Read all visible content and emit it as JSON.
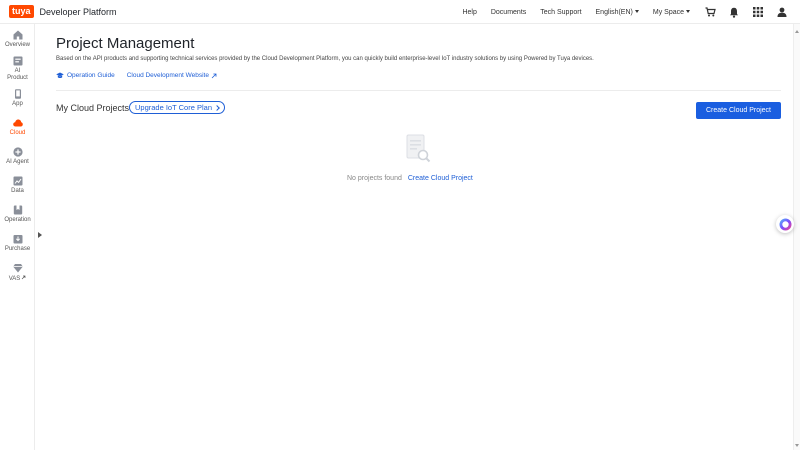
{
  "header": {
    "logo_text": "tuya",
    "brand": "Developer Platform",
    "nav": {
      "help": "Help",
      "documents": "Documents",
      "tech_support": "Tech Support",
      "language": "English(EN)",
      "space": "My Space"
    },
    "icons": [
      "cart-icon",
      "bell-icon",
      "apps-grid-icon",
      "user-icon"
    ]
  },
  "sidebar": {
    "items": [
      {
        "label": "Overview",
        "icon": "home-icon"
      },
      {
        "label": "AI Product",
        "icon": "ai-product-icon"
      },
      {
        "label": "App",
        "icon": "phone-icon"
      },
      {
        "label": "Cloud",
        "icon": "cloud-icon",
        "active": true
      },
      {
        "label": "AI Agent",
        "icon": "plus-circle-icon"
      },
      {
        "label": "Data",
        "icon": "chart-icon"
      },
      {
        "label": "Operation",
        "icon": "bookmark-icon"
      },
      {
        "label": "Purchase",
        "icon": "download-box-icon"
      },
      {
        "label": "VAS",
        "icon": "diamond-icon"
      }
    ]
  },
  "main": {
    "title": "Project Management",
    "description": "Based on the API products and supporting technical services provided by the Cloud Development Platform, you can quickly build enterprise-level IoT industry solutions by using Powered by Tuya devices.",
    "links": {
      "operation_guide": "Operation Guide",
      "cloud_dev_website": "Cloud Development Website"
    },
    "section_title": "My Cloud Projects",
    "upgrade_pill": "Upgrade IoT Core Plan",
    "create_button": "Create Cloud Project",
    "empty": {
      "text": "No projects found",
      "link": "Create Cloud Project"
    }
  },
  "colors": {
    "brand_orange": "#ff4800",
    "primary_blue": "#1a5ee0",
    "link_blue": "#1f5fd6"
  }
}
